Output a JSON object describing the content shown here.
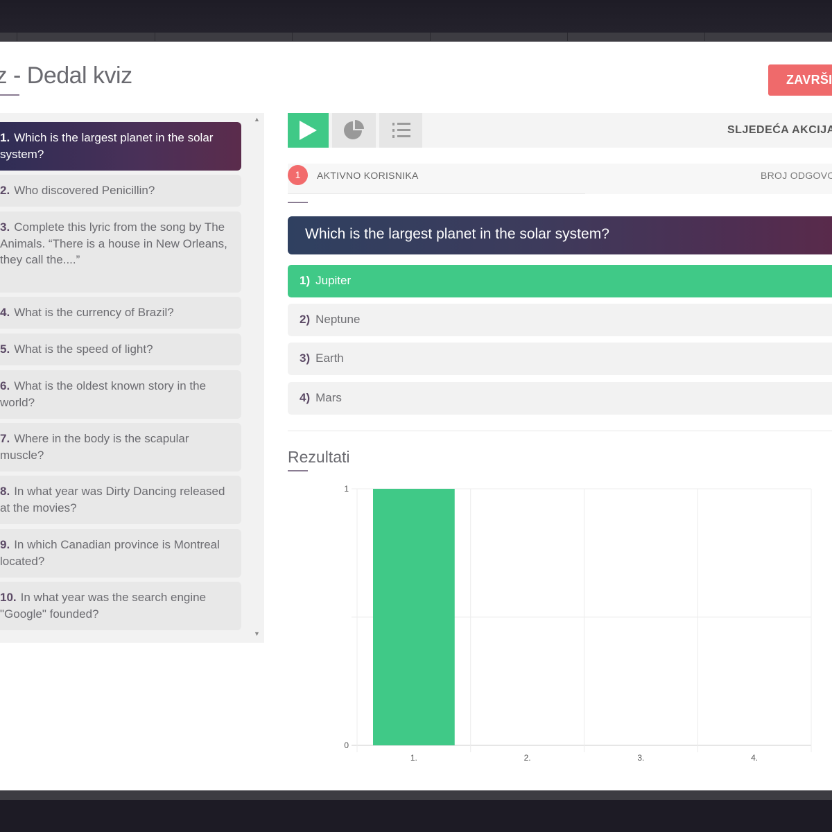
{
  "page": {
    "title": "viz - Dedal kviz",
    "finish_button": "ZAVRŠI"
  },
  "questions": [
    {
      "num": "1.",
      "text": "Which is the largest planet in the solar system?"
    },
    {
      "num": "2.",
      "text": "Who discovered Penicillin?"
    },
    {
      "num": "3.",
      "text": "Complete this lyric from the song by The Animals. “There is a house in New Orleans, they call the....”"
    },
    {
      "num": "4.",
      "text": "What is the currency of Brazil?"
    },
    {
      "num": "5.",
      "text": "What is the speed of light?"
    },
    {
      "num": "6.",
      "text": "What is the oldest known story in the world?"
    },
    {
      "num": "7.",
      "text": "Where in the body is the scapular muscle?"
    },
    {
      "num": "8.",
      "text": "In what year was Dirty Dancing released at the movies?"
    },
    {
      "num": "9.",
      "text": "In which Canadian province is Montreal located?"
    },
    {
      "num": "10.",
      "text": "In what year was the search engine \"Google\" founded?"
    }
  ],
  "toolbar": {
    "play_icon": "play-icon",
    "stats_icon": "pie-chart-icon",
    "list_icon": "list-icon",
    "next_action": "SLJEDEĆA AKCIJA"
  },
  "status": {
    "active_users_count": "1",
    "active_users_label": "AKTIVNO KORISNIKA",
    "answers_label": "BROJ ODGOVORA"
  },
  "current_question": {
    "text": "Which is the largest planet in the solar system?",
    "answers": [
      {
        "num": "1)",
        "text": "Jupiter",
        "correct": true
      },
      {
        "num": "2)",
        "text": "Neptune",
        "correct": false
      },
      {
        "num": "3)",
        "text": "Earth",
        "correct": false
      },
      {
        "num": "4)",
        "text": "Mars",
        "correct": false
      }
    ]
  },
  "results": {
    "title": "Rezultati"
  },
  "colors": {
    "accent_green": "#40c987",
    "accent_red": "#ef6a6b"
  },
  "chart_data": {
    "type": "bar",
    "categories": [
      "1.",
      "2.",
      "3.",
      "4."
    ],
    "values": [
      1,
      0,
      0,
      0
    ],
    "ylim": [
      0,
      1
    ],
    "yticks": [
      "0",
      "1"
    ],
    "grid": true,
    "bar_color": "#40c987"
  }
}
